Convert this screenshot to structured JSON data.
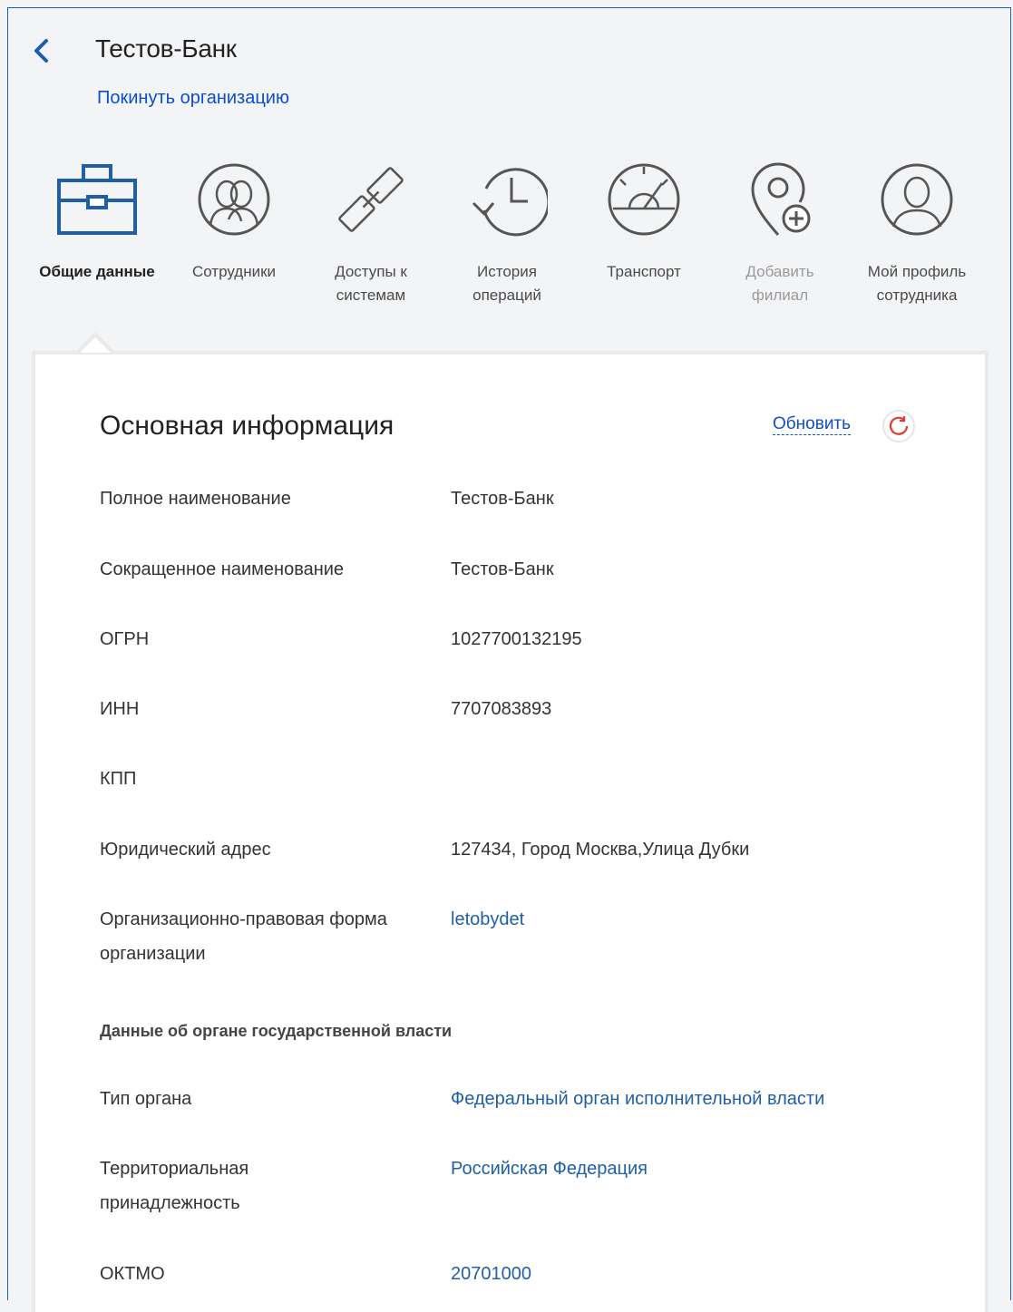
{
  "header": {
    "title": "Тестов-Банк",
    "leave_link": "Покинуть организацию"
  },
  "tabs": [
    {
      "label": "Общие данные",
      "icon": "briefcase-icon",
      "active": true
    },
    {
      "label": "Сотрудники",
      "icon": "employees-icon"
    },
    {
      "label": "Доступы к системам",
      "icon": "chain-link-icon"
    },
    {
      "label": "История операций",
      "icon": "history-clock-icon"
    },
    {
      "label": "Транспорт",
      "icon": "speedometer-icon"
    },
    {
      "label": "Добавить филиал",
      "icon": "add-location-icon",
      "disabled": true
    },
    {
      "label": "Мой профиль сотрудника",
      "icon": "profile-icon"
    }
  ],
  "main": {
    "section_title": "Основная информация",
    "refresh_label": "Обновить",
    "rows": [
      {
        "label": "Полное наименование",
        "value": "Тестов-Банк"
      },
      {
        "label": "Сокращенное наименование",
        "value": "Тестов-Банк"
      },
      {
        "label": "ОГРН",
        "value": "1027700132195"
      },
      {
        "label": "ИНН",
        "value": "7707083893"
      },
      {
        "label": "КПП",
        "value": ""
      },
      {
        "label": "Юридический адрес",
        "value": "127434, Город Москва,Улица Дубки"
      },
      {
        "label": "Организационно-правовая форма организации",
        "value": "letobydet"
      }
    ],
    "gov_subhead": "Данные об органе государственной власти",
    "gov_rows": [
      {
        "label": "Тип органа",
        "value": "Федеральный орган исполнительной власти"
      },
      {
        "label": "Территориальная принадлежность",
        "value": "Российская Федерация"
      },
      {
        "label": "ОКТМО",
        "value": "20701000"
      }
    ]
  },
  "colors": {
    "accent": "#1f5fa8",
    "link": "#0d4cd3",
    "refresh_icon": "#e53935"
  }
}
